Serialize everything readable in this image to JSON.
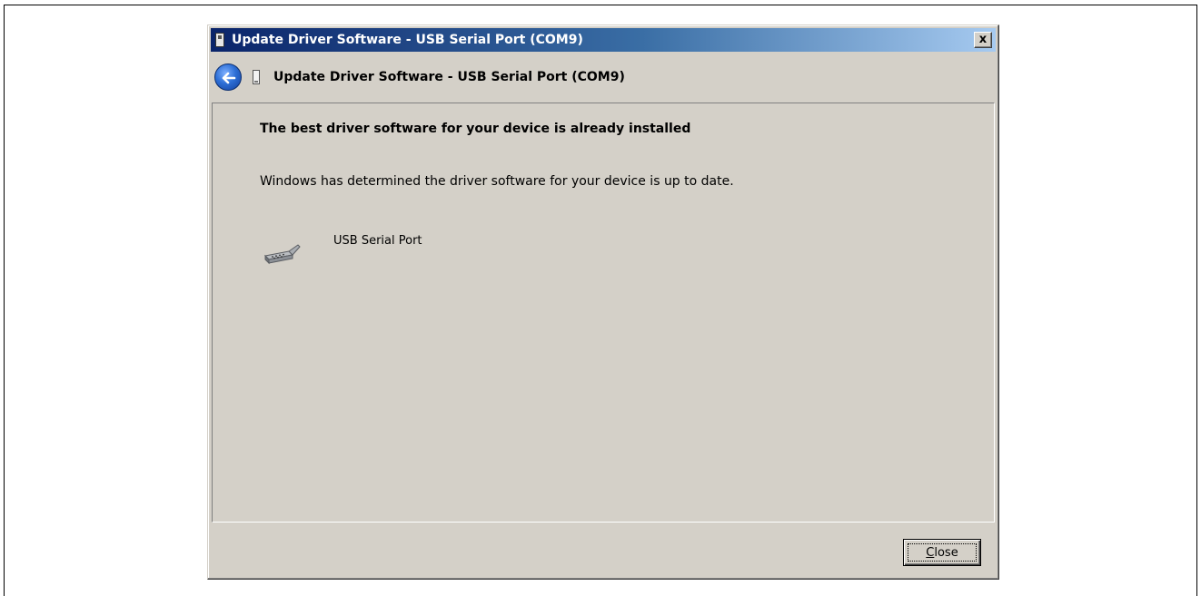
{
  "window": {
    "title": "Update Driver Software - USB Serial Port (COM9)",
    "close_glyph": "x"
  },
  "nav": {
    "back_icon": "back-arrow-icon",
    "title": "Update Driver Software - USB Serial Port (COM9)"
  },
  "content": {
    "heading": "The best driver software for your device is already installed",
    "description": "Windows has determined the driver software for your device is up to date.",
    "device_icon": "serial-port-icon",
    "device_name": "USB Serial Port"
  },
  "footer": {
    "close_label": "Close",
    "close_mnemonic": "C",
    "close_rest": "lose"
  },
  "colors": {
    "dialog_bg": "#d4d0c8",
    "title_gradient_start": "#0a246a",
    "title_gradient_end": "#a6caf0"
  }
}
